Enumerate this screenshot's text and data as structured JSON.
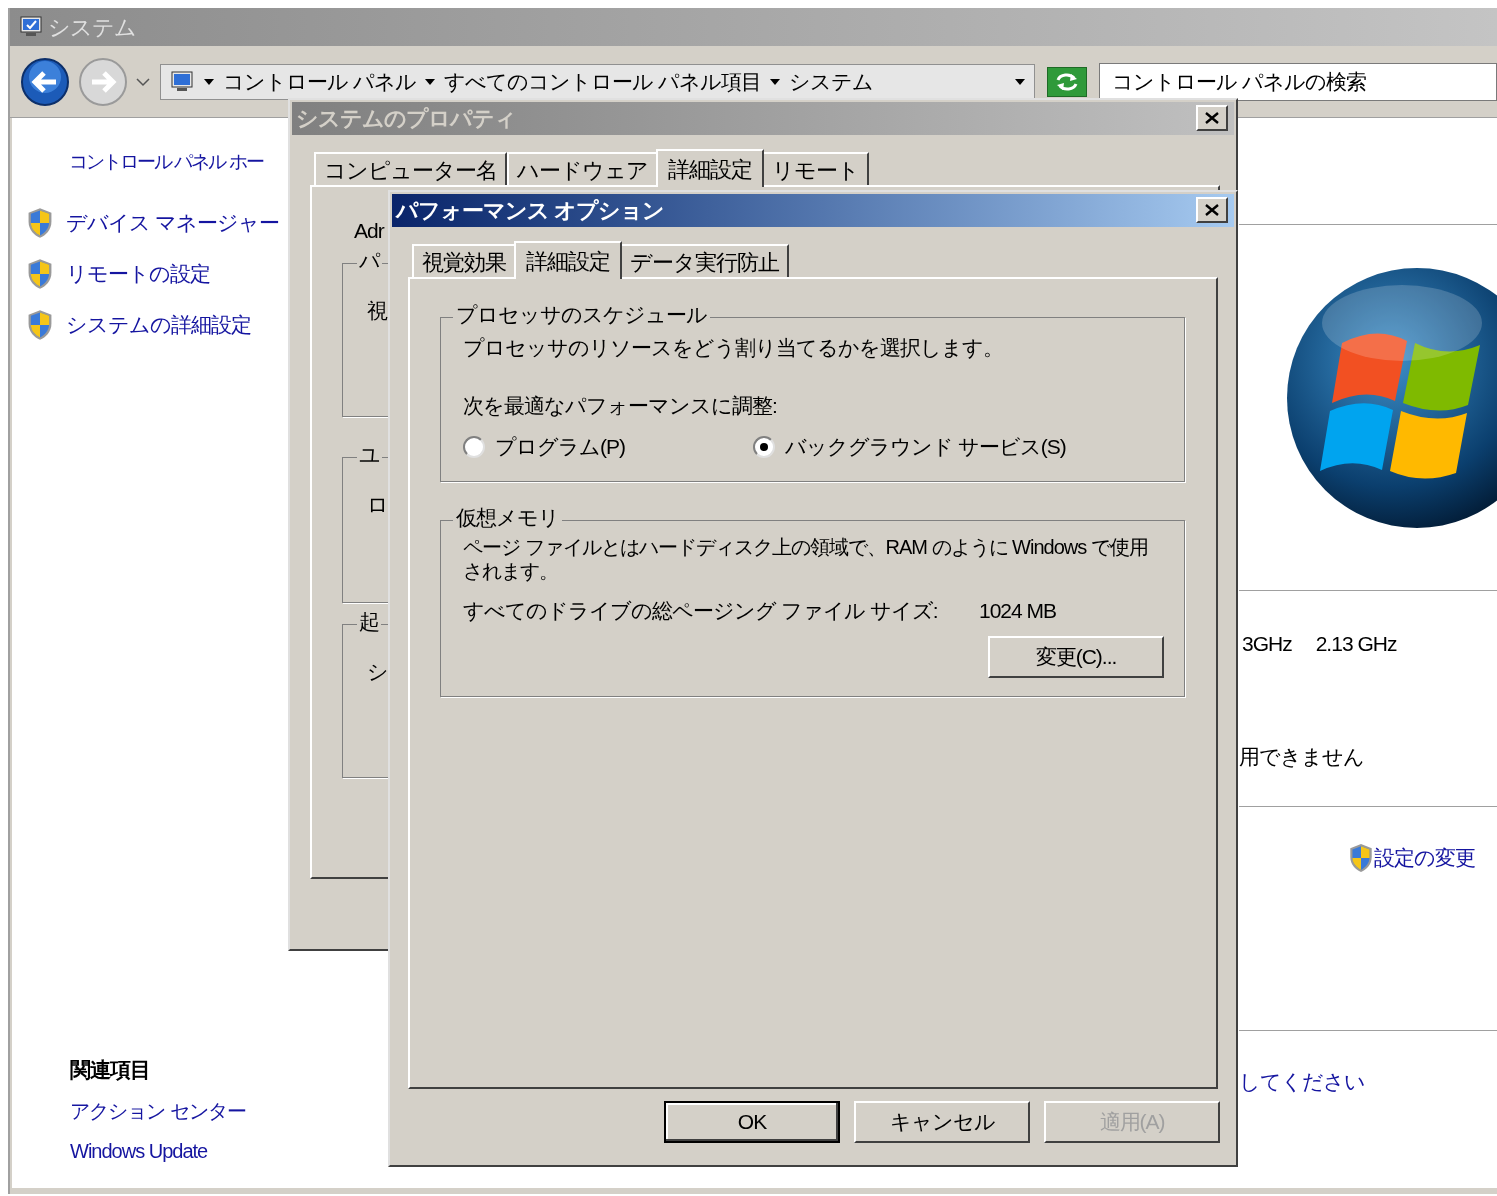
{
  "window": {
    "title": "システム"
  },
  "address_bar": {
    "breadcrumbs": [
      "コントロール パネル",
      "すべてのコントロール パネル項目",
      "システム"
    ]
  },
  "search": {
    "placeholder": "コントロール パネルの検索"
  },
  "sidebar": {
    "home_link": "コントロール パネル ホー",
    "items": [
      "デバイス マネージャー",
      "リモートの設定",
      "システムの詳細設定"
    ],
    "related_heading": "関連項目",
    "related_links": [
      "アクション センター",
      "Windows Update"
    ]
  },
  "main": {
    "clock_speed": [
      "3GHz",
      "2.13 GHz"
    ],
    "pen_touch_note": "用できません",
    "change_settings_link": "設定の変更",
    "activation_link": "してください"
  },
  "system_properties": {
    "title": "システムのプロパティ",
    "tabs": [
      {
        "label": "コンピューター名",
        "selected": false
      },
      {
        "label": "ハードウェア",
        "selected": false
      },
      {
        "label": "詳細設定",
        "selected": true
      },
      {
        "label": "リモート",
        "selected": false
      }
    ],
    "admin_note": "Adr",
    "groups": [
      {
        "legend": "パ",
        "text": "視"
      },
      {
        "legend": "ユ",
        "text": "ロ"
      },
      {
        "legend": "起",
        "text": "シ"
      }
    ]
  },
  "performance_options": {
    "title": "パフォーマンス オプション",
    "tabs": [
      {
        "label": "視覚効果",
        "selected": false
      },
      {
        "label": "詳細設定",
        "selected": true
      },
      {
        "label": "データ実行防止",
        "selected": false
      }
    ],
    "processor_scheduling": {
      "legend": "プロセッサのスケジュール",
      "description": "プロセッサのリソースをどう割り当てるかを選択します。",
      "adjust_label": "次を最適なパフォーマンスに調整:",
      "options": [
        {
          "label": "プログラム(P)",
          "selected": false
        },
        {
          "label": "バックグラウンド サービス(S)",
          "selected": true
        }
      ]
    },
    "virtual_memory": {
      "legend": "仮想メモリ",
      "description": "ページ ファイルとはハードディスク上の領域で、RAM のように Windows で使用されます。",
      "size_label": "すべてのドライブの総ページング ファイル サイズ:",
      "size_value": "1024 MB",
      "change_button": "変更(C)..."
    },
    "buttons": [
      {
        "label": "OK",
        "default": true,
        "disabled": false
      },
      {
        "label": "キャンセル",
        "default": false,
        "disabled": false
      },
      {
        "label": "適用(A)",
        "default": false,
        "disabled": true
      }
    ]
  }
}
